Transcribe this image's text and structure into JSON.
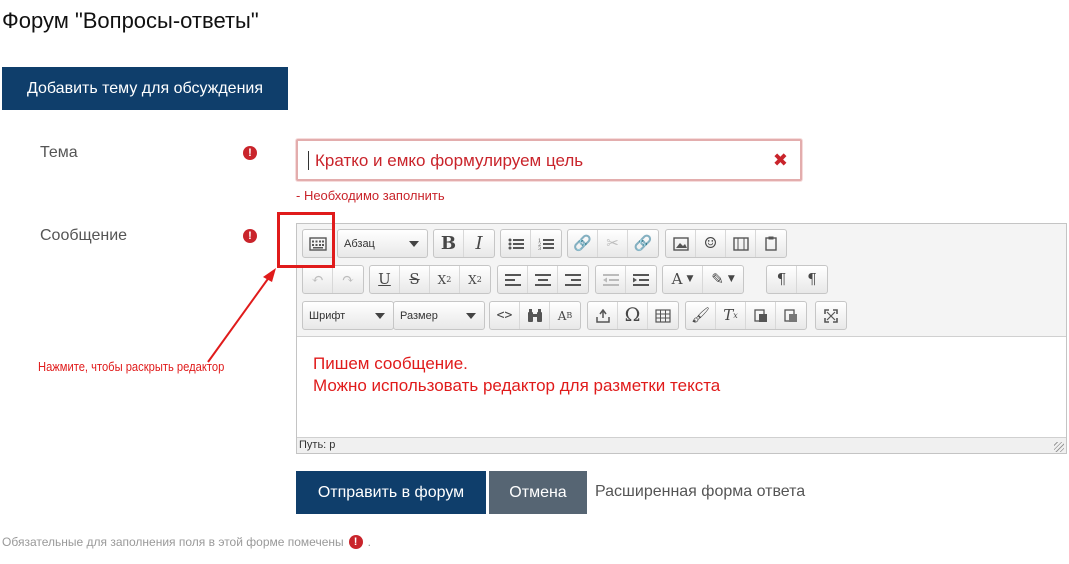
{
  "page": {
    "title": "Форум \"Вопросы-ответы\""
  },
  "actions": {
    "add_topic_label": "Добавить тему для обсуждения"
  },
  "form": {
    "subject": {
      "label": "Тема",
      "value": "Кратко и емко формулируем цель",
      "clear_glyph": "✖",
      "error": "- Необходимо заполнить"
    },
    "message": {
      "label": "Сообщение",
      "content_lines": [
        "Пишем сообщение.",
        "Можно использовать редактор для разметки текста"
      ],
      "path_label": "Путь: p"
    },
    "required_glyph": "!",
    "submit_label": "Отправить в форум",
    "cancel_label": "Отмена",
    "advanced_label": "Расширенная форма ответа",
    "footnote_text": "Обязательные для заполнения поля в этой форме помечены",
    "footnote_end": "."
  },
  "editor": {
    "paragraph_select": "Абзац",
    "font_select": "Шрифт",
    "size_select": "Размер",
    "toolbar_icons": {
      "toggle": "keyboard-toggle-icon",
      "bold": "bold-icon",
      "italic": "italic-icon",
      "bullet_list": "bullet-list-icon",
      "numbered_list": "numbered-list-icon",
      "link": "link-icon",
      "unlink": "unlink-icon",
      "anchor": "anchor-icon",
      "image": "image-icon",
      "emoticon": "emoticon-icon",
      "media": "media-icon",
      "paste": "paste-icon",
      "undo": "undo-icon",
      "redo": "redo-icon",
      "underline": "underline-icon",
      "strike": "strikethrough-icon",
      "subscript": "subscript-icon",
      "superscript": "superscript-icon",
      "align_left": "align-left-icon",
      "align_center": "align-center-icon",
      "align_right": "align-right-icon",
      "outdent": "outdent-icon",
      "indent": "indent-icon",
      "text_color": "text-color-icon",
      "bg_color": "background-color-icon",
      "ltr": "ltr-icon",
      "rtl": "rtl-icon",
      "code": "code-icon",
      "find": "find-icon",
      "spellcheck": "spellcheck-icon",
      "special_char": "special-char-icon",
      "omega": "omega-icon",
      "table": "table-icon",
      "cleanup": "cleanup-icon",
      "remove_format": "remove-format-icon",
      "paste_text": "paste-text-icon",
      "paste_word": "paste-word-icon",
      "fullscreen": "fullscreen-icon"
    }
  },
  "annotation": {
    "text": "Нажмите, чтобы раскрыть редактор",
    "color": "#e01b1b"
  },
  "colors": {
    "primary": "#0f3e6b",
    "secondary": "#566573",
    "error": "#c9242b"
  }
}
